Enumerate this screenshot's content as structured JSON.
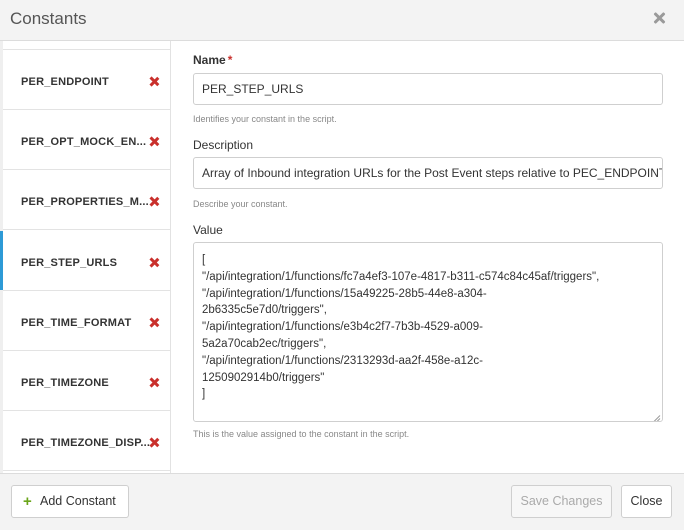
{
  "dialog": {
    "title": "Constants"
  },
  "sidebar": {
    "items": [
      {
        "label": "PER_ENDPOINT",
        "active": false
      },
      {
        "label": "PER_OPT_MOCK_EN...",
        "active": false
      },
      {
        "label": "PER_PROPERTIES_M...",
        "active": false
      },
      {
        "label": "PER_STEP_URLS",
        "active": true
      },
      {
        "label": "PER_TIME_FORMAT",
        "active": false
      },
      {
        "label": "PER_TIMEZONE",
        "active": false
      },
      {
        "label": "PER_TIMEZONE_DISP...",
        "active": false
      }
    ]
  },
  "form": {
    "name": {
      "label": "Name",
      "required_marker": "*",
      "value": "PER_STEP_URLS",
      "help": "Identifies your constant in the script."
    },
    "description": {
      "label": "Description",
      "value": "Array of Inbound integration URLs for the Post Event steps relative to PEC_ENDPOINT",
      "help": "Describe your constant."
    },
    "value": {
      "label": "Value",
      "lines": [
        "[",
        "  \"/api/integration/1/functions/fc7a4ef3-107e-4817-b311-c574c84c45af/triggers\",",
        "  \"/api/integration/1/functions/15a49225-28b5-44e8-a304-",
        "2b6335c5e7d0/triggers\",",
        "  \"/api/integration/1/functions/e3b4c2f7-7b3b-4529-a009-",
        "5a2a70cab2ec/triggers\",",
        "  \"/api/integration/1/functions/2313293d-aa2f-458e-a12c-",
        "1250902914b0/triggers\"",
        "]"
      ],
      "help": "This is the value assigned to the constant in the script."
    }
  },
  "footer": {
    "add_label": "Add Constant",
    "save_label": "Save Changes",
    "close_label": "Close"
  },
  "colors": {
    "accent": "#2d9ad6",
    "delete": "#c9302c",
    "add": "#6aa51a"
  }
}
